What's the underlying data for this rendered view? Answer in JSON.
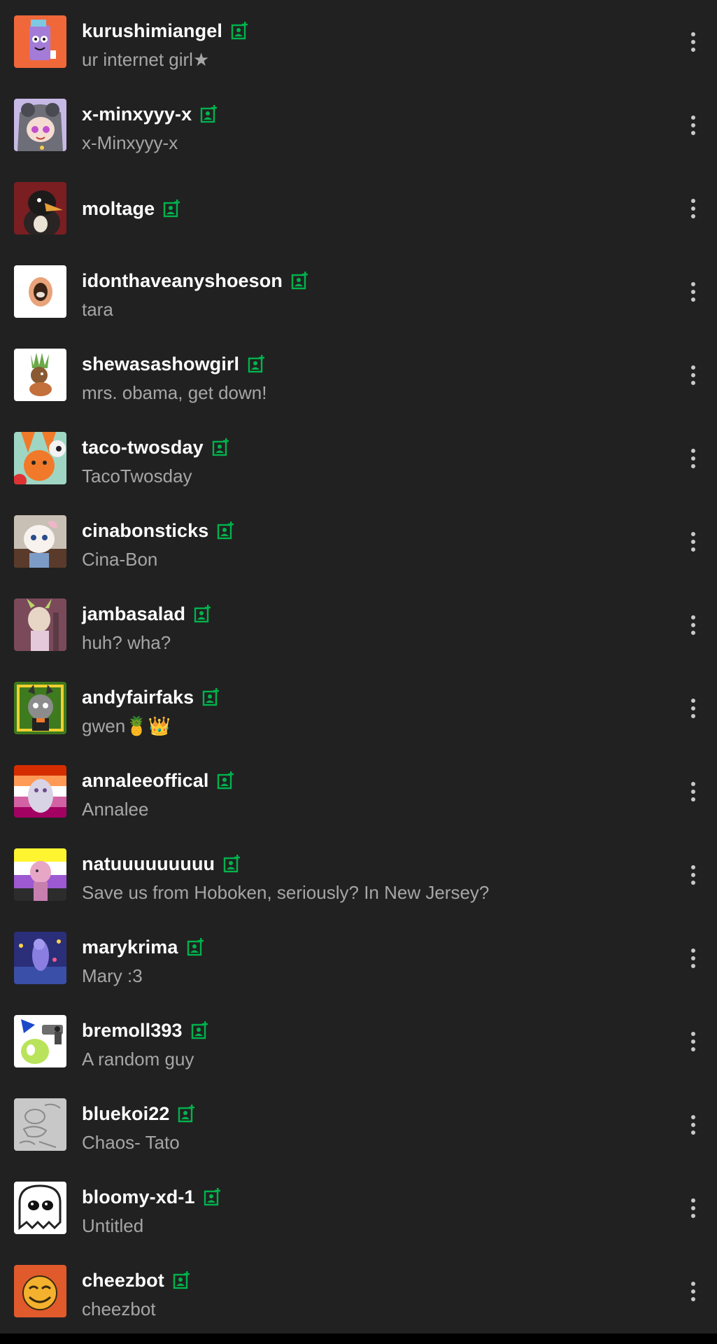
{
  "colors": {
    "background": "#212121",
    "username": "#ffffff",
    "subtitle": "#a6a6a6",
    "follow_icon": "#00b34d",
    "menu_dots": "#c9c9c9"
  },
  "rows": [
    {
      "username": "kurushimiangel",
      "title": "ur internet girl★",
      "icon": "follow-badge-icon"
    },
    {
      "username": "x-minxyyy-x",
      "title": "x-Minxyyy-x",
      "icon": "follow-badge-icon"
    },
    {
      "username": "moltage",
      "title": "",
      "icon": "follow-badge-icon"
    },
    {
      "username": "idonthaveanyshoeson",
      "title": "tara",
      "icon": "follow-badge-icon"
    },
    {
      "username": "shewasashowgirl",
      "title": "mrs. obama, get down!",
      "icon": "follow-badge-icon"
    },
    {
      "username": "taco-twosday",
      "title": "TacoTwosday",
      "icon": "follow-badge-icon"
    },
    {
      "username": "cinabonsticks",
      "title": "Cina-Bon",
      "icon": "follow-badge-icon"
    },
    {
      "username": "jambasalad",
      "title": "huh? wha?",
      "icon": "follow-badge-icon"
    },
    {
      "username": "andyfairfaks",
      "title": "gwen🍍👑",
      "icon": "follow-badge-icon"
    },
    {
      "username": "annaleeoffical",
      "title": "Annalee",
      "icon": "follow-badge-icon"
    },
    {
      "username": "natuuuuuuuuu",
      "title": "Save us from Hoboken, seriously? In New Jersey?",
      "icon": "follow-badge-icon"
    },
    {
      "username": "marykrima",
      "title": "Mary :3",
      "icon": "follow-badge-icon"
    },
    {
      "username": "bremoll393",
      "title": "A random guy",
      "icon": "follow-badge-icon"
    },
    {
      "username": "bluekoi22",
      "title": "Chaos- Tato",
      "icon": "follow-badge-icon"
    },
    {
      "username": "bloomy-xd-1",
      "title": "Untitled",
      "icon": "follow-badge-icon"
    },
    {
      "username": "cheezbot",
      "title": "cheezbot",
      "icon": "follow-badge-icon"
    }
  ]
}
